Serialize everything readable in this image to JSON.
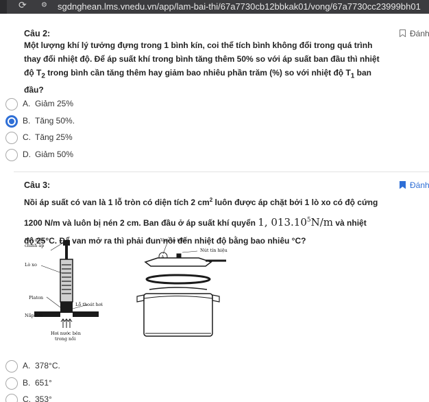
{
  "browser": {
    "url": "sgdnghean.lms.vnedu.vn/app/lam-bai-thi/67a7730cb12bbkak01/vong/67a7730cc23999bh01",
    "reload_icon": "reload-icon",
    "site_info_icon": "site-info-icon"
  },
  "question2": {
    "title": "Câu 2:",
    "mark_label": "Đánh",
    "mark_state": "unmarked",
    "text_line1": "Một lượng khí lý tưởng đựng trong 1 bình kín, coi thể tích bình không đổi trong quá trình",
    "text_line2": "thay đổi nhiệt độ. Để áp suất khí trong bình tăng thêm 50% so với áp suất ban đầu thì nhiệt",
    "text_line3_a": "độ T",
    "text_line3_sub1": "2",
    "text_line3_b": " trong bình cần tăng thêm hay giảm bao nhiêu phần trăm (%) so với nhiệt độ T",
    "text_line3_sub2": "1",
    "text_line3_c": " ban",
    "text_line4": "đầu?",
    "options": [
      {
        "letter": "A.",
        "text": "Giảm 25%",
        "selected": false
      },
      {
        "letter": "B.",
        "text": "Tăng 50%.",
        "selected": true
      },
      {
        "letter": "C.",
        "text": "Tăng 25%",
        "selected": false
      },
      {
        "letter": "D.",
        "text": "Giảm 50%",
        "selected": false
      }
    ]
  },
  "question3": {
    "title": "Câu 3:",
    "mark_label": "Đánh",
    "mark_state": "marked",
    "text_line1_a": "Nồi áp suất có van là 1 lỗ tròn có diện tích 2 cm",
    "text_line1_sup": "2",
    "text_line1_b": " luôn được áp chặt bởi 1 lò xo có độ cứng",
    "text_line2_a": "1200 N/m và luôn bị nén 2 cm. Ban đầu ở áp suất khí quyển ",
    "text_line2_math_a": "1, 013.10",
    "text_line2_math_sup": "5",
    "text_line2_math_b": "N/m",
    "text_line2_c": " và nhiệt",
    "text_line3": "độ 25°C. Để van mở ra thì phải đun nồi đến nhiệt độ bằng bao nhiêu °C?",
    "figure_labels": {
      "nut_dieu_1": "Nút điều",
      "nut_dieu_2": "chỉnh áp",
      "lo_xo": "Lò xo",
      "platon": "Platon",
      "lo_thoat_hoi": "Lỗ thoát hơi",
      "nap_noi": "Nắp nồi",
      "hoi_nuoc_1": "Hơi nước bên",
      "hoi_nuoc_2": "trong nồi",
      "van_an_toan": "Van an toàn",
      "nut_tin_hieu": "Nút tín hiệu",
      "a_mark": "A"
    },
    "options": [
      {
        "letter": "A.",
        "text": "378°C."
      },
      {
        "letter": "B.",
        "text": "651°"
      },
      {
        "letter": "C.",
        "text": "353°"
      }
    ]
  },
  "colors": {
    "accent": "#2f6fd6",
    "chrome": "#3c3c3f",
    "text": "#222222"
  }
}
